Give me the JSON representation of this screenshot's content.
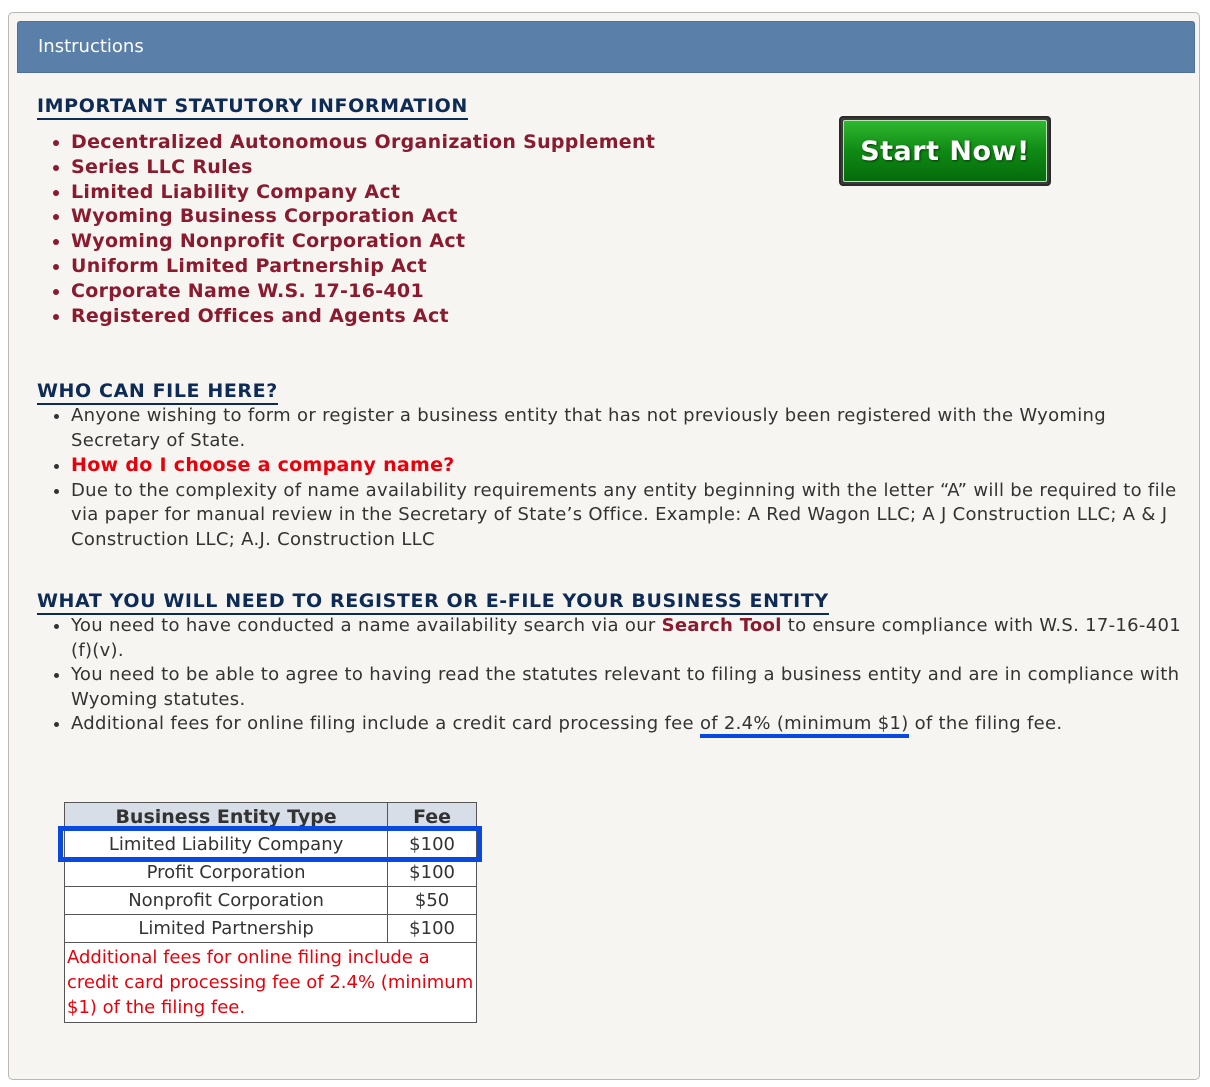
{
  "header": {
    "title": "Instructions"
  },
  "statutory": {
    "heading": "IMPORTANT STATUTORY INFORMATION",
    "items": [
      "Decentralized Autonomous Organization Supplement",
      "Series LLC Rules",
      "Limited Liability Company Act",
      "Wyoming Business Corporation Act",
      "Wyoming Nonprofit Corporation Act",
      "Uniform Limited Partnership Act",
      "Corporate Name W.S. 17-16-401",
      "Registered Offices and Agents Act"
    ]
  },
  "start_button": {
    "label": "Start Now!"
  },
  "who": {
    "heading": "WHO CAN FILE HERE?",
    "item1": "Anyone wishing to form or register a business entity that has not previously been registered with the Wyoming Secretary of State.",
    "item2": "How do I choose a company name?",
    "item3": "Due to the complexity of name availability requirements any entity beginning with the letter “A” will be required to file via paper for manual review in the Secretary of State’s Office. Example: A Red Wagon LLC; A J Construction LLC; A & J Construction LLC; A.J. Construction LLC"
  },
  "need": {
    "heading": "WHAT YOU WILL NEED TO REGISTER OR E-FILE YOUR BUSINESS ENTITY",
    "item1_pre": "You need to have conducted a name availability search via our ",
    "item1_link": "Search Tool",
    "item1_post": " to ensure compliance with W.S. 17-16-401 (f)(v).",
    "item2": "You need to be able to agree to having read the statutes relevant to filing a business entity and are in compliance with Wyoming statutes.",
    "item3_pre": "Additional fees for online filing include a credit card processing fee ",
    "item3_mark": "of 2.4% (minimum $1)",
    "item3_post": " of the filing fee."
  },
  "fee_table": {
    "headers": [
      "Business Entity Type",
      "Fee"
    ],
    "rows": [
      {
        "type": "Limited Liability Company",
        "fee": "$100"
      },
      {
        "type": "Profit Corporation",
        "fee": "$100"
      },
      {
        "type": "Nonprofit Corporation",
        "fee": "$50"
      },
      {
        "type": "Limited Partnership",
        "fee": "$100"
      }
    ],
    "note": "Additional fees for online filing include a credit card processing fee of 2.4% (minimum $1) of the filing fee."
  },
  "colors": {
    "header_bg": "#5a7fa8",
    "heading": "#0d2b55",
    "link_dark_red": "#8a1a2e",
    "link_red": "#e8000b",
    "button_green": "#0f8a14",
    "highlight_blue": "#0a49e0"
  }
}
